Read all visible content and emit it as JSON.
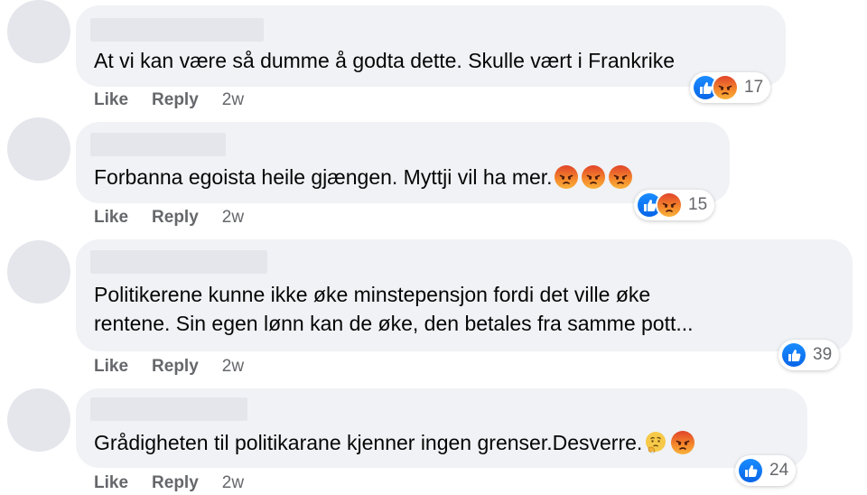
{
  "actions": {
    "like_label": "Like",
    "reply_label": "Reply"
  },
  "colors": {
    "bubble_bg": "#f0f2f5",
    "placeholder": "#e4e6eb",
    "secondary_text": "#65676b",
    "like_blue": "#1877f2",
    "angry_orange": "#f46b1f"
  },
  "comments": [
    {
      "text": "At vi kan være så dumme å godta dette. Skulle vært i Frankrike",
      "time": "2w",
      "reactions": [
        "like-icon",
        "angry-icon"
      ],
      "reaction_count": "17"
    },
    {
      "text": "Forbanna egoista heile gjængen. Myttji vil ha mer.",
      "inline_emojis": [
        "angry-emoji",
        "angry-emoji",
        "angry-emoji"
      ],
      "time": "2w",
      "reactions": [
        "like-icon",
        "angry-icon"
      ],
      "reaction_count": "15"
    },
    {
      "text_line1": "Politikerene kunne ikke øke minstepensjon fordi det ville øke",
      "text_line2": "rentene. Sin egen lønn kan de øke, den betales fra samme pott...",
      "time": "2w",
      "reactions": [
        "like-icon"
      ],
      "reaction_count": "39"
    },
    {
      "text": "Grådigheten til politikarane kjenner ingen grenser.Desverre.",
      "inline_emojis": [
        "thinking-emoji",
        "angry-emoji"
      ],
      "time": "2w",
      "reactions": [
        "like-icon"
      ],
      "reaction_count": "24"
    }
  ]
}
